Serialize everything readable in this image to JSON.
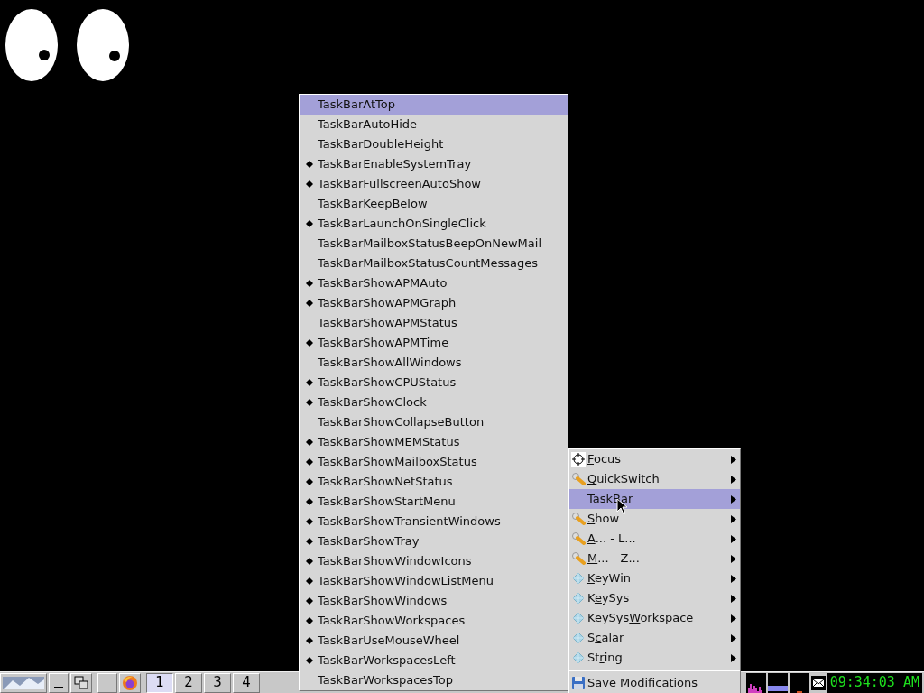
{
  "prefs_menu": {
    "items": [
      {
        "label": "TaskBarAtTop",
        "checked": false,
        "selected": true
      },
      {
        "label": "TaskBarAutoHide",
        "checked": false,
        "selected": false
      },
      {
        "label": "TaskBarDoubleHeight",
        "checked": false,
        "selected": false
      },
      {
        "label": "TaskBarEnableSystemTray",
        "checked": true,
        "selected": false
      },
      {
        "label": "TaskBarFullscreenAutoShow",
        "checked": true,
        "selected": false
      },
      {
        "label": "TaskBarKeepBelow",
        "checked": false,
        "selected": false
      },
      {
        "label": "TaskBarLaunchOnSingleClick",
        "checked": true,
        "selected": false
      },
      {
        "label": "TaskBarMailboxStatusBeepOnNewMail",
        "checked": false,
        "selected": false
      },
      {
        "label": "TaskBarMailboxStatusCountMessages",
        "checked": false,
        "selected": false
      },
      {
        "label": "TaskBarShowAPMAuto",
        "checked": true,
        "selected": false
      },
      {
        "label": "TaskBarShowAPMGraph",
        "checked": true,
        "selected": false
      },
      {
        "label": "TaskBarShowAPMStatus",
        "checked": false,
        "selected": false
      },
      {
        "label": "TaskBarShowAPMTime",
        "checked": true,
        "selected": false
      },
      {
        "label": "TaskBarShowAllWindows",
        "checked": false,
        "selected": false
      },
      {
        "label": "TaskBarShowCPUStatus",
        "checked": true,
        "selected": false
      },
      {
        "label": "TaskBarShowClock",
        "checked": true,
        "selected": false
      },
      {
        "label": "TaskBarShowCollapseButton",
        "checked": false,
        "selected": false
      },
      {
        "label": "TaskBarShowMEMStatus",
        "checked": true,
        "selected": false
      },
      {
        "label": "TaskBarShowMailboxStatus",
        "checked": true,
        "selected": false
      },
      {
        "label": "TaskBarShowNetStatus",
        "checked": true,
        "selected": false
      },
      {
        "label": "TaskBarShowStartMenu",
        "checked": true,
        "selected": false
      },
      {
        "label": "TaskBarShowTransientWindows",
        "checked": true,
        "selected": false
      },
      {
        "label": "TaskBarShowTray",
        "checked": true,
        "selected": false
      },
      {
        "label": "TaskBarShowWindowIcons",
        "checked": true,
        "selected": false
      },
      {
        "label": "TaskBarShowWindowListMenu",
        "checked": true,
        "selected": false
      },
      {
        "label": "TaskBarShowWindows",
        "checked": true,
        "selected": false
      },
      {
        "label": "TaskBarShowWorkspaces",
        "checked": true,
        "selected": false
      },
      {
        "label": "TaskBarUseMouseWheel",
        "checked": true,
        "selected": false
      },
      {
        "label": "TaskBarWorkspacesLeft",
        "checked": true,
        "selected": false
      },
      {
        "label": "TaskBarWorkspacesTop",
        "checked": false,
        "selected": false
      }
    ]
  },
  "settings_menu": {
    "items": [
      {
        "kind": "submenu",
        "accel": "F",
        "label_post": "ocus",
        "selected": false
      },
      {
        "kind": "submenu",
        "accel": "Q",
        "label_post": "uickSwitch",
        "selected": false
      },
      {
        "kind": "submenu",
        "accel": "T",
        "label_post": "askBar",
        "selected": true
      },
      {
        "kind": "submenu",
        "accel": "S",
        "label_post": "how",
        "selected": false
      },
      {
        "kind": "submenu",
        "accel": "A",
        "label_post": "... - L...",
        "selected": false
      },
      {
        "kind": "submenu",
        "accel": "M",
        "label_post": "... - Z...",
        "selected": false
      },
      {
        "kind": "submenu",
        "accel": "K",
        "label_post": "eyWin",
        "selected": false
      },
      {
        "kind": "submenu",
        "label_pre": "K",
        "accel": "e",
        "label_post": "ySys",
        "selected": false
      },
      {
        "kind": "submenu",
        "label_pre": "KeySys",
        "accel": "W",
        "label_post": "orkspace",
        "selected": false
      },
      {
        "kind": "submenu",
        "label_pre": "S",
        "accel": "c",
        "label_post": "alar",
        "selected": false
      },
      {
        "kind": "submenu",
        "label_pre": "St",
        "accel": "r",
        "label_post": "ing",
        "selected": false
      },
      {
        "kind": "separator"
      },
      {
        "kind": "action",
        "label_pre": "Save Modifications",
        "selected": false
      }
    ]
  },
  "taskbar": {
    "workspaces": [
      {
        "label": "1",
        "selected": true
      },
      {
        "label": "2",
        "selected": false
      },
      {
        "label": "3",
        "selected": false
      },
      {
        "label": "4",
        "selected": false
      }
    ],
    "clock": "09:34:03 AM"
  }
}
